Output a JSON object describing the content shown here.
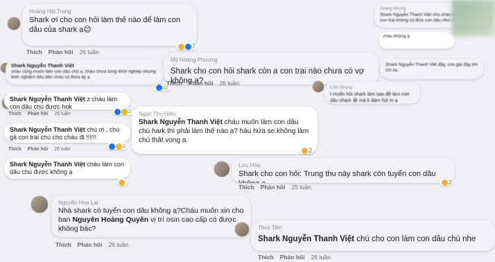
{
  "actions": {
    "like": "Thích",
    "reply": "Phản hồi"
  },
  "comments": [
    {
      "name": "Hoàng Hải Trang",
      "text": "Shark ơi cho con hỏi làm thế nào để làm con dâu của shark ạ😊",
      "time": "26 tuần",
      "count": "7"
    },
    {
      "name": "Shark Nguyễn Thanh Việt",
      "text": "cháu cũng muốn làm con dâu chú ạ, cháu chưa từng khởi nghiệp nhưng kinh nghiệm tiêu tiền cháu có thừa ấy ạ",
      "time": "26 tuần",
      "count": "22"
    },
    {
      "name": "Mỹ Hoàng Phương",
      "text": "Shark cho con hỏi shark còn a con trai nào chưa có vợ không ạ?",
      "time": "26 tuần",
      "count": ""
    },
    {
      "name": "Shark Nguyễn Thanh Việt",
      "text": "z cháu làm con dâu chú được hok",
      "time": "26 tuần",
      "count": "2"
    },
    {
      "name": "Shark Nguyễn Thanh Việt",
      "text": "chú ơi , chú gả con trai chú cho cháu đi !!!!!!",
      "time": "26 tuần",
      "count": "2"
    },
    {
      "name": "Shark Nguyễn Thanh Việt",
      "text": "cháu làm con dâu chú được không ạ",
      "time": "26 tuần",
      "count": ""
    },
    {
      "name": "Nguyễn Hoa Lai",
      "text_prefix": "Nhà shark có tuyển con dâu không ạ?Cháu muôn xin cho ban ",
      "mention": "Nguyên Hoàng Quyên",
      "text_suffix": " vị trí osin cao cấp có được không bác?",
      "time": "26 tuần",
      "count": ""
    },
    {
      "name": "Ngọc Thu Hiền",
      "text_prefix": "Shark Nguyễn Thanh Việt",
      "text": " cháu muôn làm con dâu chú hark thì phải làm thế nào ạ? háu hứa se.không làm chú thât vong a.",
      "time": "26 tuần",
      "count": "2"
    },
    {
      "name": "Lưu Hòa",
      "text": "Shark cho con hỏi: Trung thu này shark còn tuyển con dâu không ạ",
      "time": "25 tuần",
      "count": "2"
    },
    {
      "name": "Thuý Tiên",
      "text_prefix": "Shark Nguyễn Thanh Việt",
      "text": " chú cho con làm con dâu chú nhe",
      "time": "26 tuần",
      "count": ""
    },
    {
      "name": "Cẩm Nhung",
      "text": "t muốn hỏi shark làm sao để làm con dâu shark 😄 mà k dám hỏi m ạ",
      "time": "26 tuần",
      "count": ""
    },
    {
      "name": "Hoàng Nhung",
      "text": "Shark Nguyễn Thanh Việt cho cháu hỏi chú có con trai không có đứa con dâu như cháu",
      "time": "26 tuần",
      "count": ""
    },
    {
      "name": "Shark Nguyễn Thanh Việt",
      "text": "Shark Nguyễn Thanh Việt đây, con gái đây tim chi xa.",
      "time": "26 tuần",
      "count": ""
    }
  ]
}
